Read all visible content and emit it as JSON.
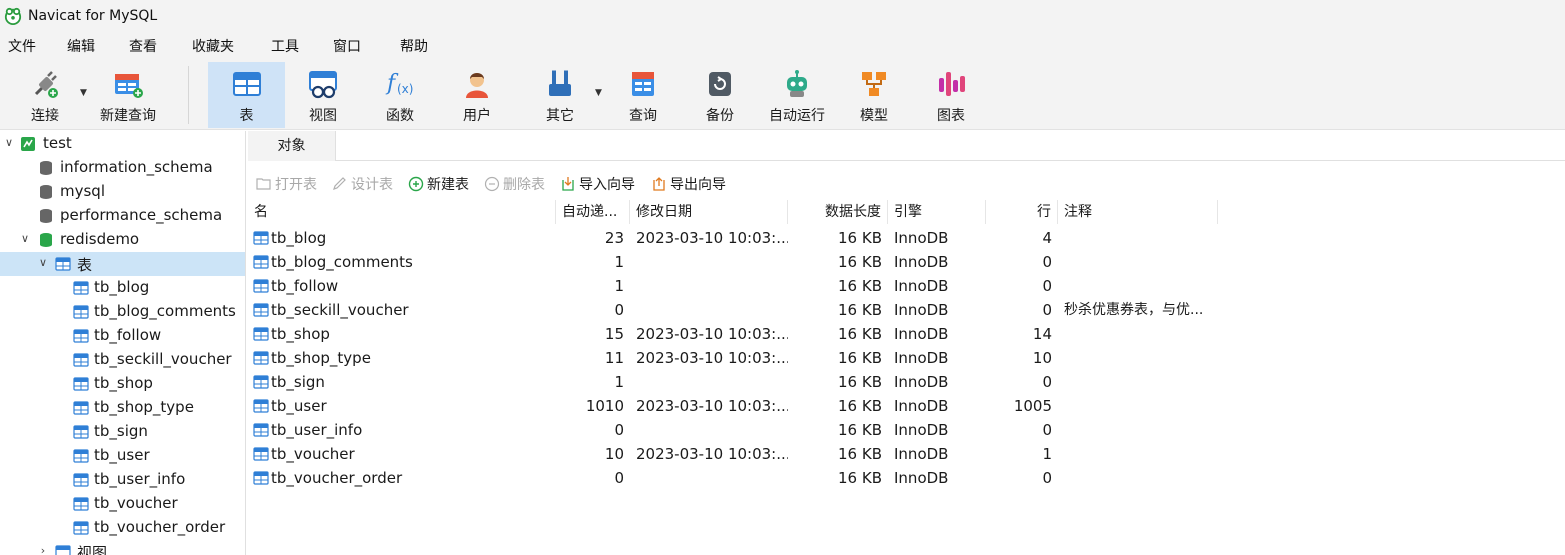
{
  "window": {
    "title": "Navicat for MySQL"
  },
  "menu": [
    "文件",
    "编辑",
    "查看",
    "收藏夹",
    "工具",
    "窗口",
    "帮助"
  ],
  "toolbar": {
    "connect": "连接",
    "new_query": "新建查询",
    "table": "表",
    "view": "视图",
    "function": "函数",
    "user": "用户",
    "other": "其它",
    "query": "查询",
    "backup": "备份",
    "automation": "自动运行",
    "model": "模型",
    "chart": "图表"
  },
  "sidebar": {
    "connection": "test",
    "databases": [
      "information_schema",
      "mysql",
      "performance_schema",
      "redisdemo"
    ],
    "tables_node": "表",
    "tables": [
      "tb_blog",
      "tb_blog_comments",
      "tb_follow",
      "tb_seckill_voucher",
      "tb_shop",
      "tb_shop_type",
      "tb_sign",
      "tb_user",
      "tb_user_info",
      "tb_voucher",
      "tb_voucher_order"
    ],
    "views_node": "视图"
  },
  "tabs": {
    "objects": "对象"
  },
  "object_toolbar": {
    "open_table": "打开表",
    "design_table": "设计表",
    "new_table": "新建表",
    "delete_table": "删除表",
    "import_wizard": "导入向导",
    "export_wizard": "导出向导"
  },
  "grid": {
    "headers": {
      "name": "名",
      "auto_inc": "自动递...",
      "modified": "修改日期",
      "data_length": "数据长度",
      "engine": "引擎",
      "rows": "行",
      "comment": "注释"
    },
    "rows": [
      {
        "name": "tb_blog",
        "auto_inc": "23",
        "modified": "2023-03-10 10:03:...",
        "data_length": "16 KB",
        "engine": "InnoDB",
        "rows": "4",
        "comment": ""
      },
      {
        "name": "tb_blog_comments",
        "auto_inc": "1",
        "modified": "",
        "data_length": "16 KB",
        "engine": "InnoDB",
        "rows": "0",
        "comment": ""
      },
      {
        "name": "tb_follow",
        "auto_inc": "1",
        "modified": "",
        "data_length": "16 KB",
        "engine": "InnoDB",
        "rows": "0",
        "comment": ""
      },
      {
        "name": "tb_seckill_voucher",
        "auto_inc": "0",
        "modified": "",
        "data_length": "16 KB",
        "engine": "InnoDB",
        "rows": "0",
        "comment": "秒杀优惠券表，与优..."
      },
      {
        "name": "tb_shop",
        "auto_inc": "15",
        "modified": "2023-03-10 10:03:...",
        "data_length": "16 KB",
        "engine": "InnoDB",
        "rows": "14",
        "comment": ""
      },
      {
        "name": "tb_shop_type",
        "auto_inc": "11",
        "modified": "2023-03-10 10:03:...",
        "data_length": "16 KB",
        "engine": "InnoDB",
        "rows": "10",
        "comment": ""
      },
      {
        "name": "tb_sign",
        "auto_inc": "1",
        "modified": "",
        "data_length": "16 KB",
        "engine": "InnoDB",
        "rows": "0",
        "comment": ""
      },
      {
        "name": "tb_user",
        "auto_inc": "1010",
        "modified": "2023-03-10 10:03:...",
        "data_length": "16 KB",
        "engine": "InnoDB",
        "rows": "1005",
        "comment": ""
      },
      {
        "name": "tb_user_info",
        "auto_inc": "0",
        "modified": "",
        "data_length": "16 KB",
        "engine": "InnoDB",
        "rows": "0",
        "comment": ""
      },
      {
        "name": "tb_voucher",
        "auto_inc": "10",
        "modified": "2023-03-10 10:03:...",
        "data_length": "16 KB",
        "engine": "InnoDB",
        "rows": "1",
        "comment": ""
      },
      {
        "name": "tb_voucher_order",
        "auto_inc": "0",
        "modified": "",
        "data_length": "16 KB",
        "engine": "InnoDB",
        "rows": "0",
        "comment": ""
      }
    ]
  },
  "colors": {
    "accent": "#cfe3f7",
    "selection": "#cce4f7",
    "table_icon": "#2f7fd6",
    "db_active": "#2aa64a",
    "logo": "#2b9c3f"
  }
}
